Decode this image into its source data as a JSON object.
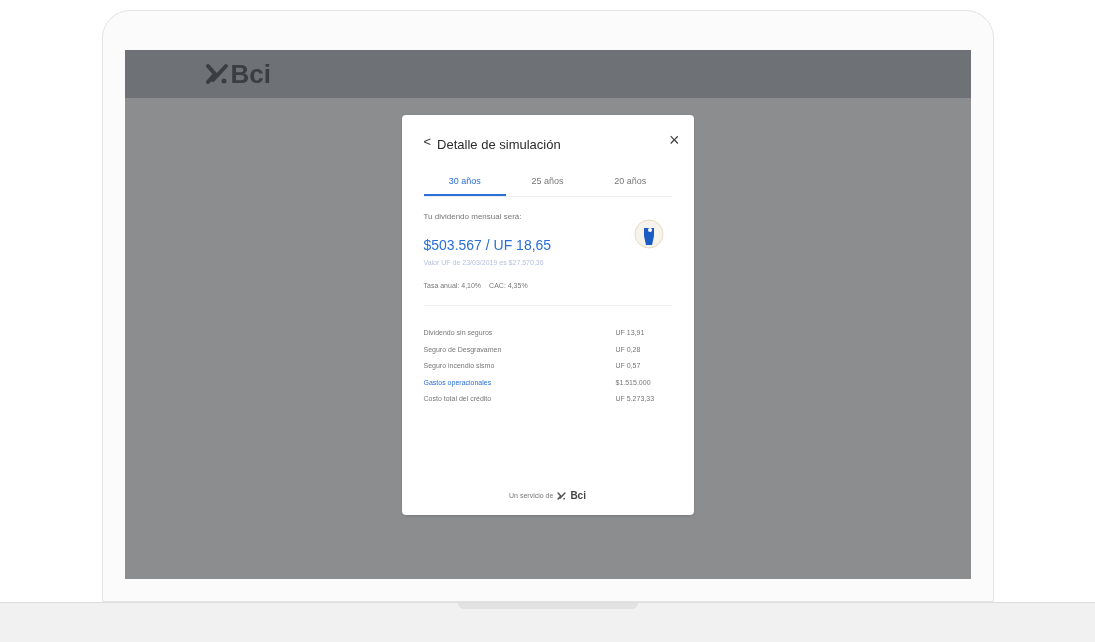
{
  "header": {
    "logo_text": "Bci"
  },
  "modal": {
    "title": "Detalle de simulación",
    "back_icon": "<",
    "close_icon": "×",
    "tabs": [
      {
        "label": "30 años",
        "selected": true
      },
      {
        "label": "25 años",
        "selected": false
      },
      {
        "label": "20 años",
        "selected": false
      }
    ],
    "dividend_label": "Tu dividendo mensual será:",
    "amount": "$503.567 / UF 18,65",
    "uf_note": "Valor UF de 23/03/2019 es $27.570,36",
    "rates": [
      "Tasa anual: 4,10%",
      "CAC: 4,35%"
    ],
    "rows": [
      {
        "label": "Dividendo sin seguros",
        "value": "UF 13,91",
        "link": false
      },
      {
        "label": "Seguro de Desgravamen",
        "value": "UF 0,28",
        "link": false
      },
      {
        "label": "Seguro incendio sismo",
        "value": "UF 0,57",
        "link": false
      },
      {
        "label": "Gastos operacionales",
        "value": "$1.515.000",
        "link": true
      },
      {
        "label": "Costo total del crédito",
        "value": "UF 5.273,33",
        "link": false
      }
    ],
    "footer": {
      "text": "Un servicio de",
      "logo_text": "Bci"
    }
  }
}
